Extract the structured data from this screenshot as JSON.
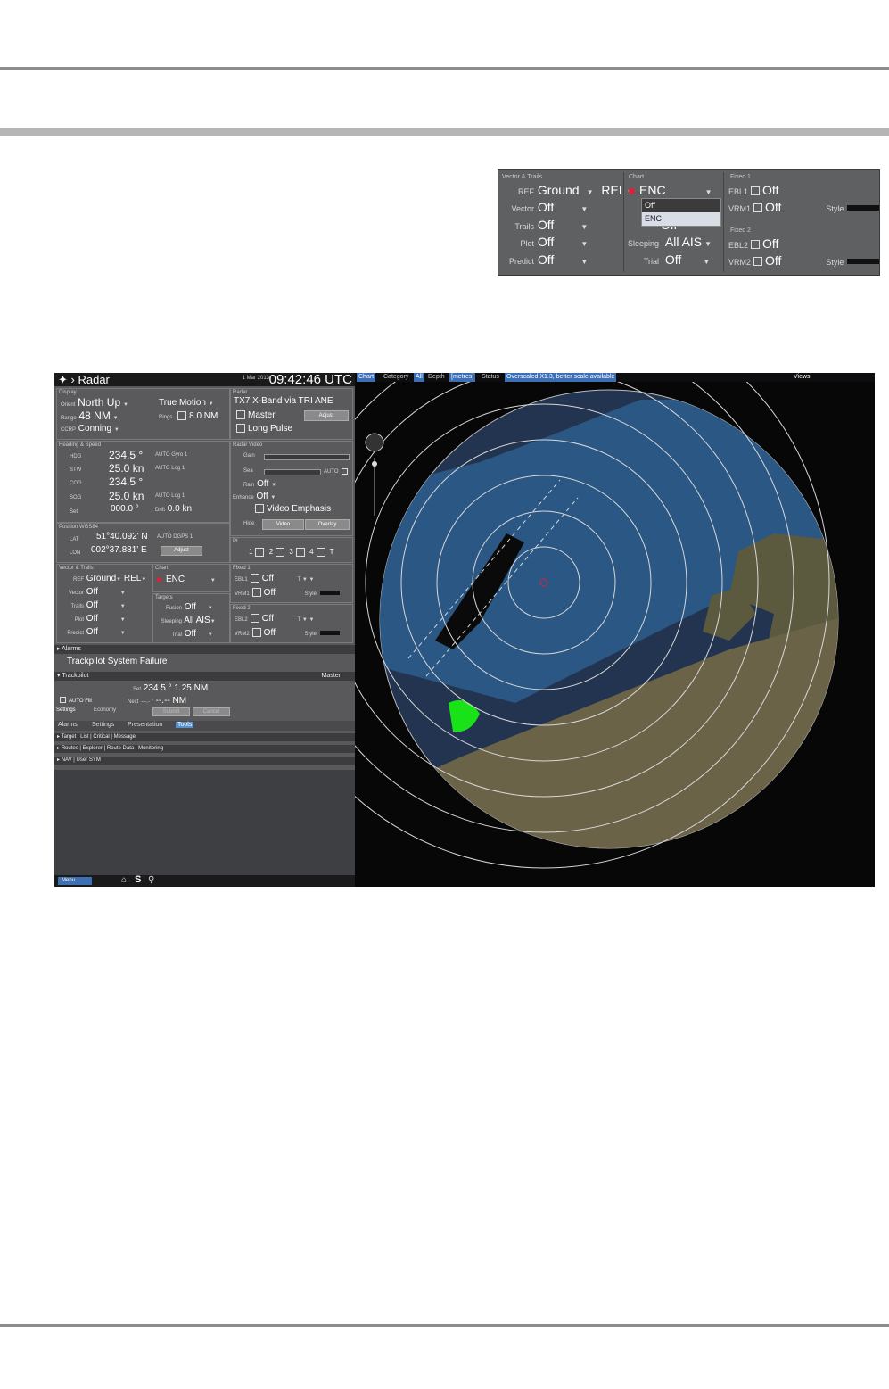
{
  "inset": {
    "headers": {
      "vector": "Vector & Trails",
      "chart": "Chart",
      "fixed1": "Fixed 1",
      "fixed2": "Fixed 2",
      "targets": "Targets"
    },
    "ref": {
      "label": "REF",
      "value": "Ground",
      "mode": "REL"
    },
    "vector": {
      "label": "Vector",
      "value": "Off"
    },
    "trails": {
      "label": "Trails",
      "value": "Off"
    },
    "plot": {
      "label": "Plot",
      "value": "Off"
    },
    "predict": {
      "label": "Predict",
      "value": "Off"
    },
    "chart_value": "ENC",
    "dropdown_options": [
      "Off",
      "ENC"
    ],
    "fusion_value": "Off",
    "sleeping": {
      "label": "Sleeping",
      "value": "All AIS"
    },
    "trial": {
      "label": "Trial",
      "value": "Off"
    },
    "ebl1": {
      "label": "EBL1",
      "value": "Off"
    },
    "vrm1": {
      "label": "VRM1",
      "value": "Off"
    },
    "ebl2": {
      "label": "EBL2",
      "value": "Off"
    },
    "vrm2": {
      "label": "VRM2",
      "value": "Off"
    },
    "style_label": "Style"
  },
  "radar": {
    "title": "Radar",
    "date": "1 Mar 2013",
    "time": "09:42:46 UTC",
    "display": {
      "header": "Display",
      "orient_label": "Orient",
      "orient": "North Up",
      "motion": "True Motion",
      "range_label": "Range",
      "range": "48 NM",
      "rings_label": "Rings",
      "rings": "8.0 NM",
      "ccrp_label": "CCRP",
      "ccrp": "Conning"
    },
    "radar_box": {
      "header": "Radar",
      "source": "TX7 X-Band via TRI ANE",
      "master": "Master",
      "adjust": "Adjust",
      "long_pulse": "Long Pulse"
    },
    "heading": {
      "header": "Heading & Speed",
      "hdg_label": "HDG",
      "hdg": "234.5 °",
      "hdg_src": "AUTO Gyro 1",
      "stw_label": "STW",
      "stw": "25.0 kn",
      "stw_src": "AUTO Log 1",
      "cog_label": "COG",
      "cog": "234.5 °",
      "sog_label": "SOG",
      "sog": "25.0 kn",
      "sog_src": "AUTO Log 1",
      "set_label": "Set",
      "set": "000.0 °",
      "drift_label": "Drift",
      "drift": "0.0 kn"
    },
    "video": {
      "header": "Radar Video",
      "gain": "Gain",
      "sea": "Sea",
      "sea_auto": "AUTO",
      "rain_label": "Rain",
      "rain": "Off",
      "enhance_label": "Enhance",
      "enhance": "Off",
      "video_emphasis": "Video Emphasis",
      "hide": "Hide",
      "video_btn": "Video",
      "overlay_btn": "Overlay"
    },
    "position": {
      "header": "Position WGS84",
      "lat_label": "LAT",
      "lat": "51°40.092' N",
      "lat_src": "AUTO DGPS 1",
      "lon_label": "LON",
      "lon": "002°37.881' E",
      "adjust": "Adjust"
    },
    "pi": {
      "header": "PI",
      "items": [
        "1",
        "2",
        "3",
        "4"
      ],
      "t": "T"
    },
    "vector_trails": {
      "header": "Vector & Trails",
      "ref": "Ground",
      "ref_mode": "REL",
      "vector": "Off",
      "trails": "Off",
      "plot": "Off",
      "predict": "Off",
      "ref_label": "REF",
      "vector_label": "Vector",
      "trails_label": "Trails",
      "plot_label": "Plot",
      "predict_label": "Predict"
    },
    "chart_box": {
      "header": "Chart",
      "value": "ENC"
    },
    "targets": {
      "header": "Targets",
      "fusion_label": "Fusion",
      "fusion": "Off",
      "sleeping_label": "Sleeping",
      "sleeping": "All AIS",
      "trial_label": "Trial",
      "trial": "Off"
    },
    "fixed1": {
      "header": "Fixed 1",
      "ebl": "Off",
      "vrm": "Off",
      "ebl_label": "EBL1",
      "vrm_label": "VRM1",
      "style": "Style"
    },
    "fixed2": {
      "header": "Fixed 2",
      "ebl": "Off",
      "vrm": "Off",
      "ebl_label": "EBL2",
      "vrm_label": "VRM2",
      "style": "Style"
    },
    "alarms": {
      "label": "Alarms",
      "message": "Trackpilot System Failure"
    },
    "trackpilot": {
      "label": "Trackpilot",
      "master": "Master",
      "set_label": "Set",
      "set": "234.5 °",
      "set_dist": "1.25 NM",
      "auto_fill": "AUTO Fill",
      "next_label": "Next",
      "next": "---.- °",
      "next_dist": "--.-- NM",
      "settings": "Settings",
      "economy": "Economy",
      "submit": "Submit",
      "cancel": "Cancel"
    },
    "tabs": [
      "Alarms",
      "Settings",
      "Presentation",
      "Tools"
    ],
    "collapsed": [
      {
        "title": "Target",
        "sub": "List | Critical | Message"
      },
      {
        "title": "Routes",
        "sub": "Explorer | Route Data | Monitoring"
      },
      {
        "title": "NAV",
        "sub": "User SYM"
      }
    ],
    "menu": "Menu"
  },
  "chart": {
    "label": "Chart",
    "category_label": "Category",
    "category": "All",
    "depth_label": "Depth",
    "depth": "[metres]",
    "status_label": "Status",
    "status": "Overscaled X1.3, better scale available",
    "views": "Views"
  }
}
